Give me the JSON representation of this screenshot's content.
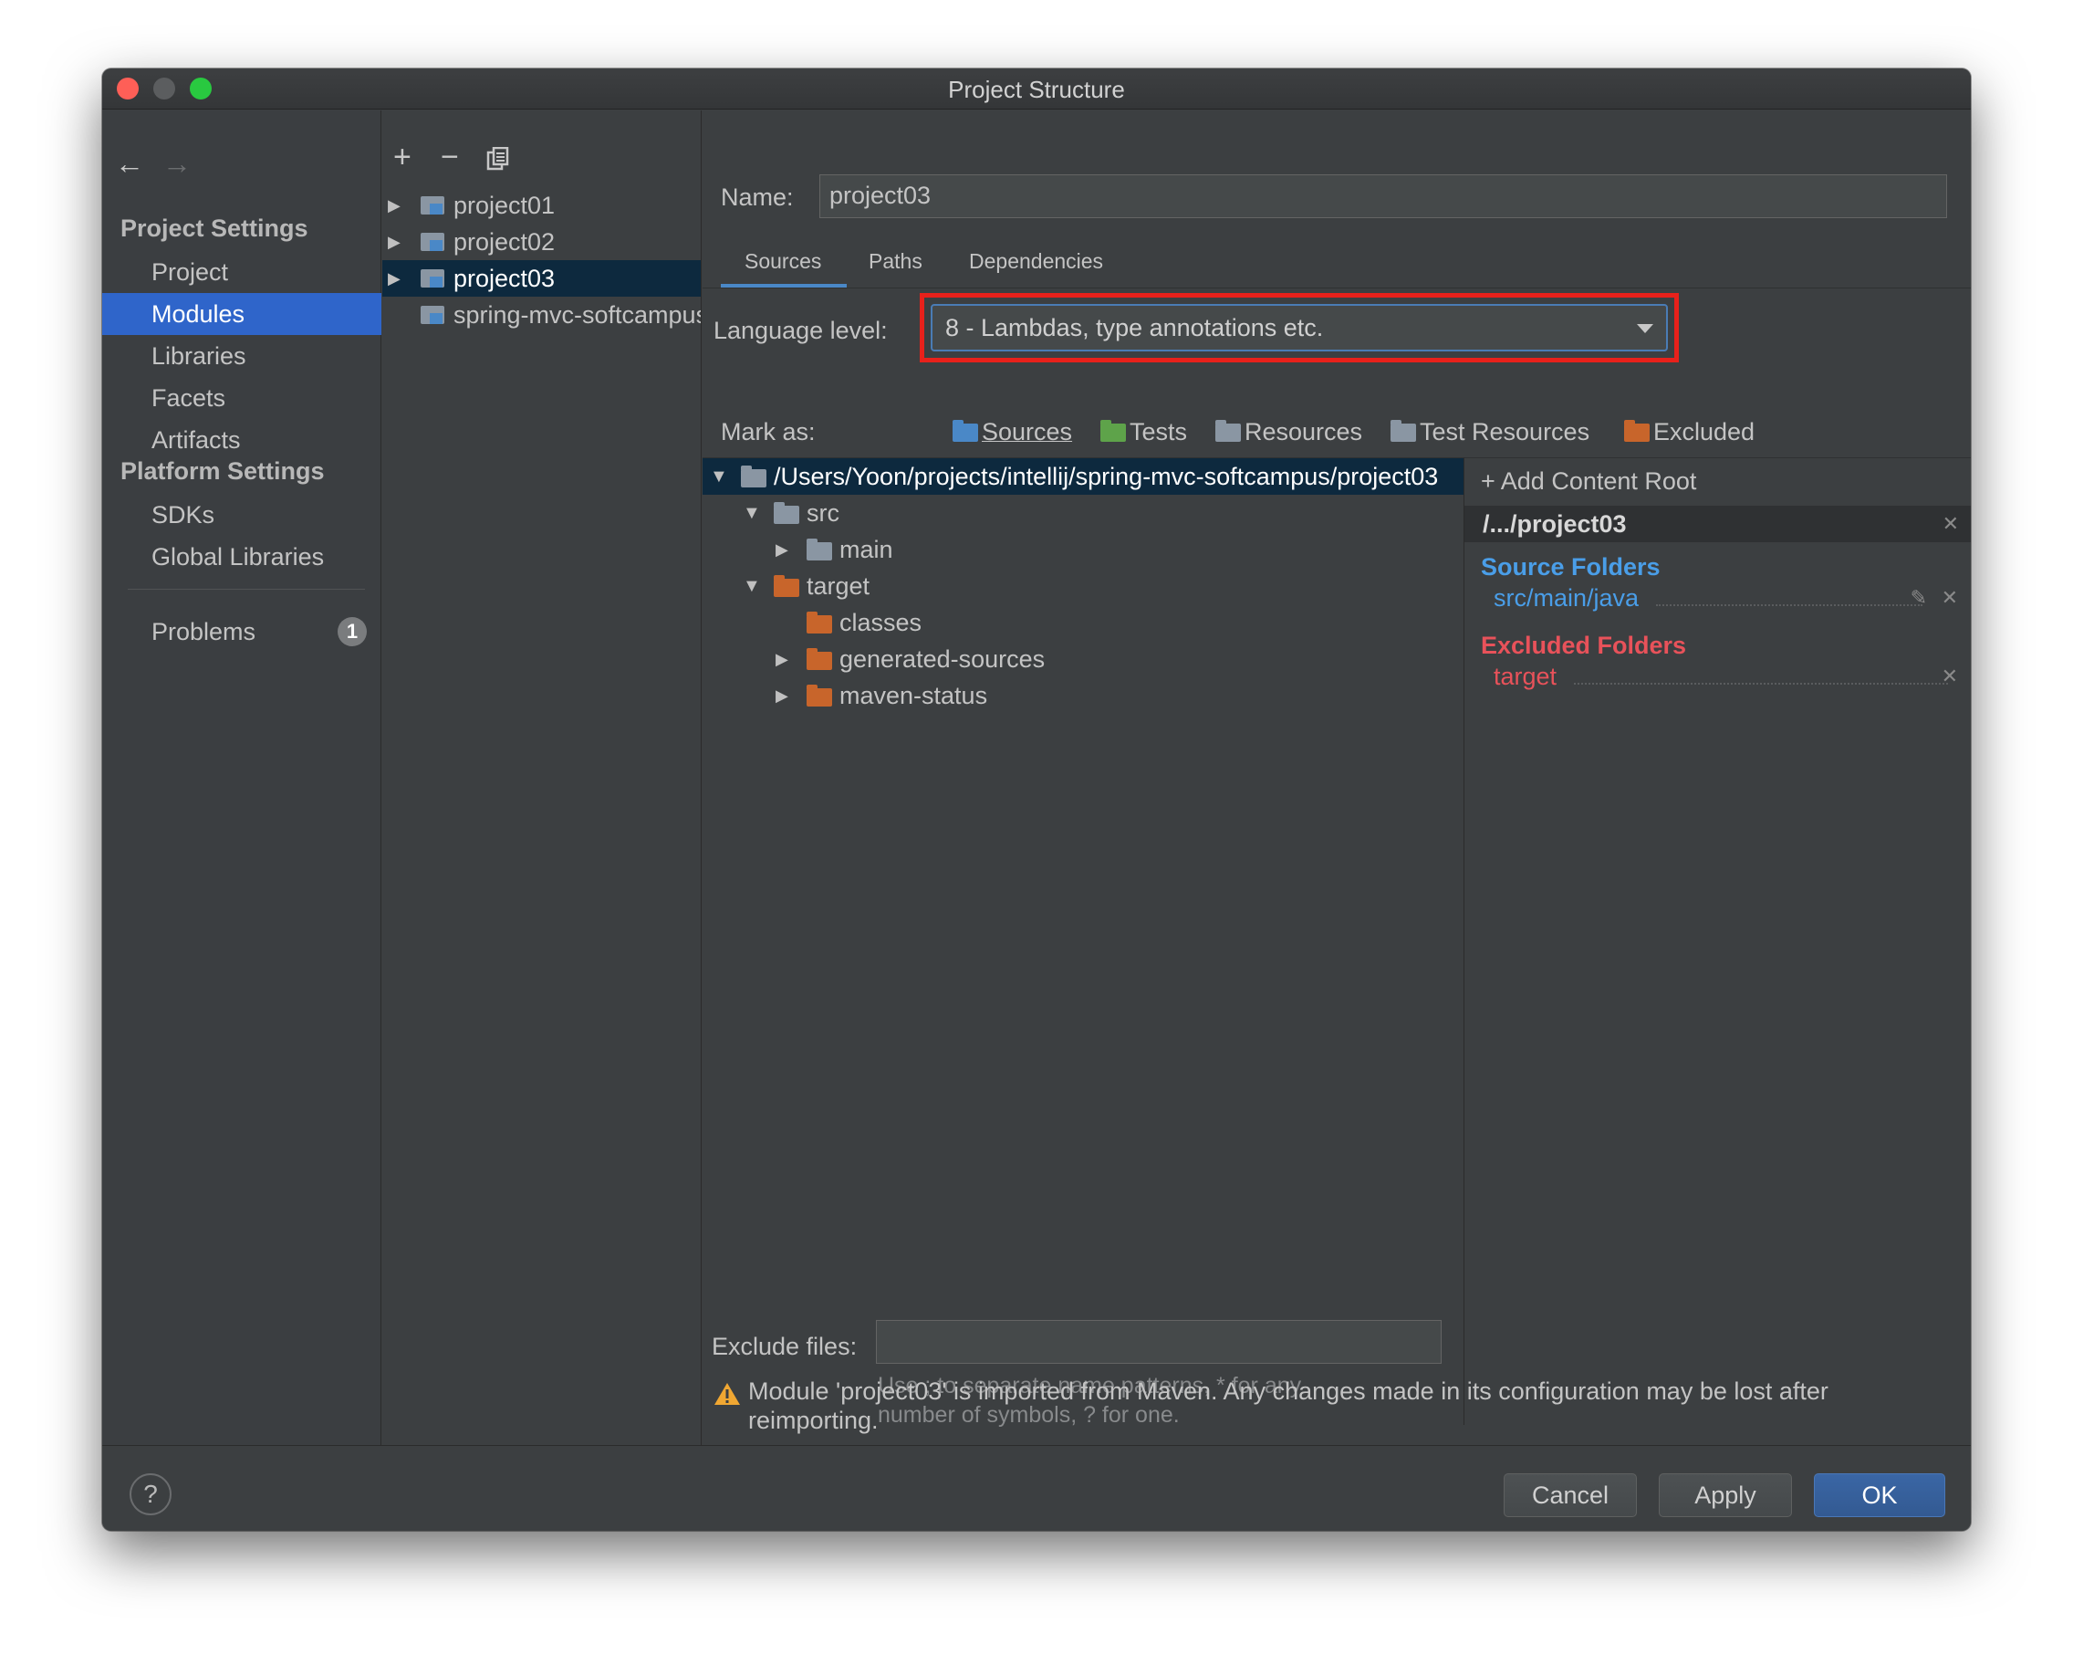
{
  "window": {
    "title": "Project Structure"
  },
  "nav": {
    "back_icon": "arrow-left-icon",
    "forward_icon": "arrow-right-icon",
    "project_settings_heading": "Project Settings",
    "platform_settings_heading": "Platform Settings",
    "project_items": [
      "Project",
      "Modules",
      "Libraries",
      "Facets",
      "Artifacts"
    ],
    "platform_items": [
      "SDKs",
      "Global Libraries"
    ],
    "selected": "Modules",
    "problems_label": "Problems",
    "problems_count": "1"
  },
  "modules_toolbar": {
    "add": "+",
    "remove": "−",
    "copy_icon": "copy-icon"
  },
  "modules": [
    {
      "name": "project01",
      "expandable": true
    },
    {
      "name": "project02",
      "expandable": true
    },
    {
      "name": "project03",
      "expandable": true,
      "selected": true
    },
    {
      "name": "spring-mvc-softcampus",
      "expandable": false
    }
  ],
  "name_label": "Name:",
  "name_value": "project03",
  "tabs": [
    "Sources",
    "Paths",
    "Dependencies"
  ],
  "active_tab": "Sources",
  "language_level_label": "Language level:",
  "language_level_value": "8 - Lambdas, type annotations etc.",
  "mark_as_label": "Mark as:",
  "mark_as": [
    {
      "label": "Sources",
      "color": "#4a88c7"
    },
    {
      "label": "Tests",
      "color": "#5ea34a"
    },
    {
      "label": "Resources",
      "color": "#8a96a3"
    },
    {
      "label": "Test Resources",
      "color": "#8a96a3"
    },
    {
      "label": "Excluded",
      "color": "#c8652b"
    }
  ],
  "tree": [
    {
      "label": "/Users/Yoon/projects/intellij/spring-mvc-softcampus/project03",
      "color": "#8a96a3",
      "arrow": "down",
      "selected": true
    },
    {
      "label": "src",
      "color": "#8a96a3",
      "arrow": "down"
    },
    {
      "label": "main",
      "color": "#8a96a3",
      "arrow": "right"
    },
    {
      "label": "target",
      "color": "#c8652b",
      "arrow": "down"
    },
    {
      "label": "classes",
      "color": "#c8652b",
      "arrow": "none"
    },
    {
      "label": "generated-sources",
      "color": "#c8652b",
      "arrow": "right"
    },
    {
      "label": "maven-status",
      "color": "#c8652b",
      "arrow": "right"
    }
  ],
  "content_roots": {
    "add_label": "+ Add Content Root",
    "root": "/.../project03",
    "source_heading": "Source Folders",
    "source_path": "src/main/java",
    "excluded_heading": "Excluded Folders",
    "excluded_path": "target",
    "colors": {
      "source": "#4a9ee8",
      "excluded": "#e8525a"
    }
  },
  "exclude_files_label": "Exclude files:",
  "exclude_files_value": "",
  "exclude_hint_line1": "Use ; to separate name patterns, * for any",
  "exclude_hint_line2": "number of symbols, ? for one.",
  "warning_icon": "warning-icon",
  "warning_line1": "Module 'project03' is imported from Maven. Any changes made in its configuration may be lost after",
  "warning_line2": "reimporting.",
  "buttons": {
    "help": "?",
    "cancel": "Cancel",
    "apply": "Apply",
    "ok": "OK"
  }
}
